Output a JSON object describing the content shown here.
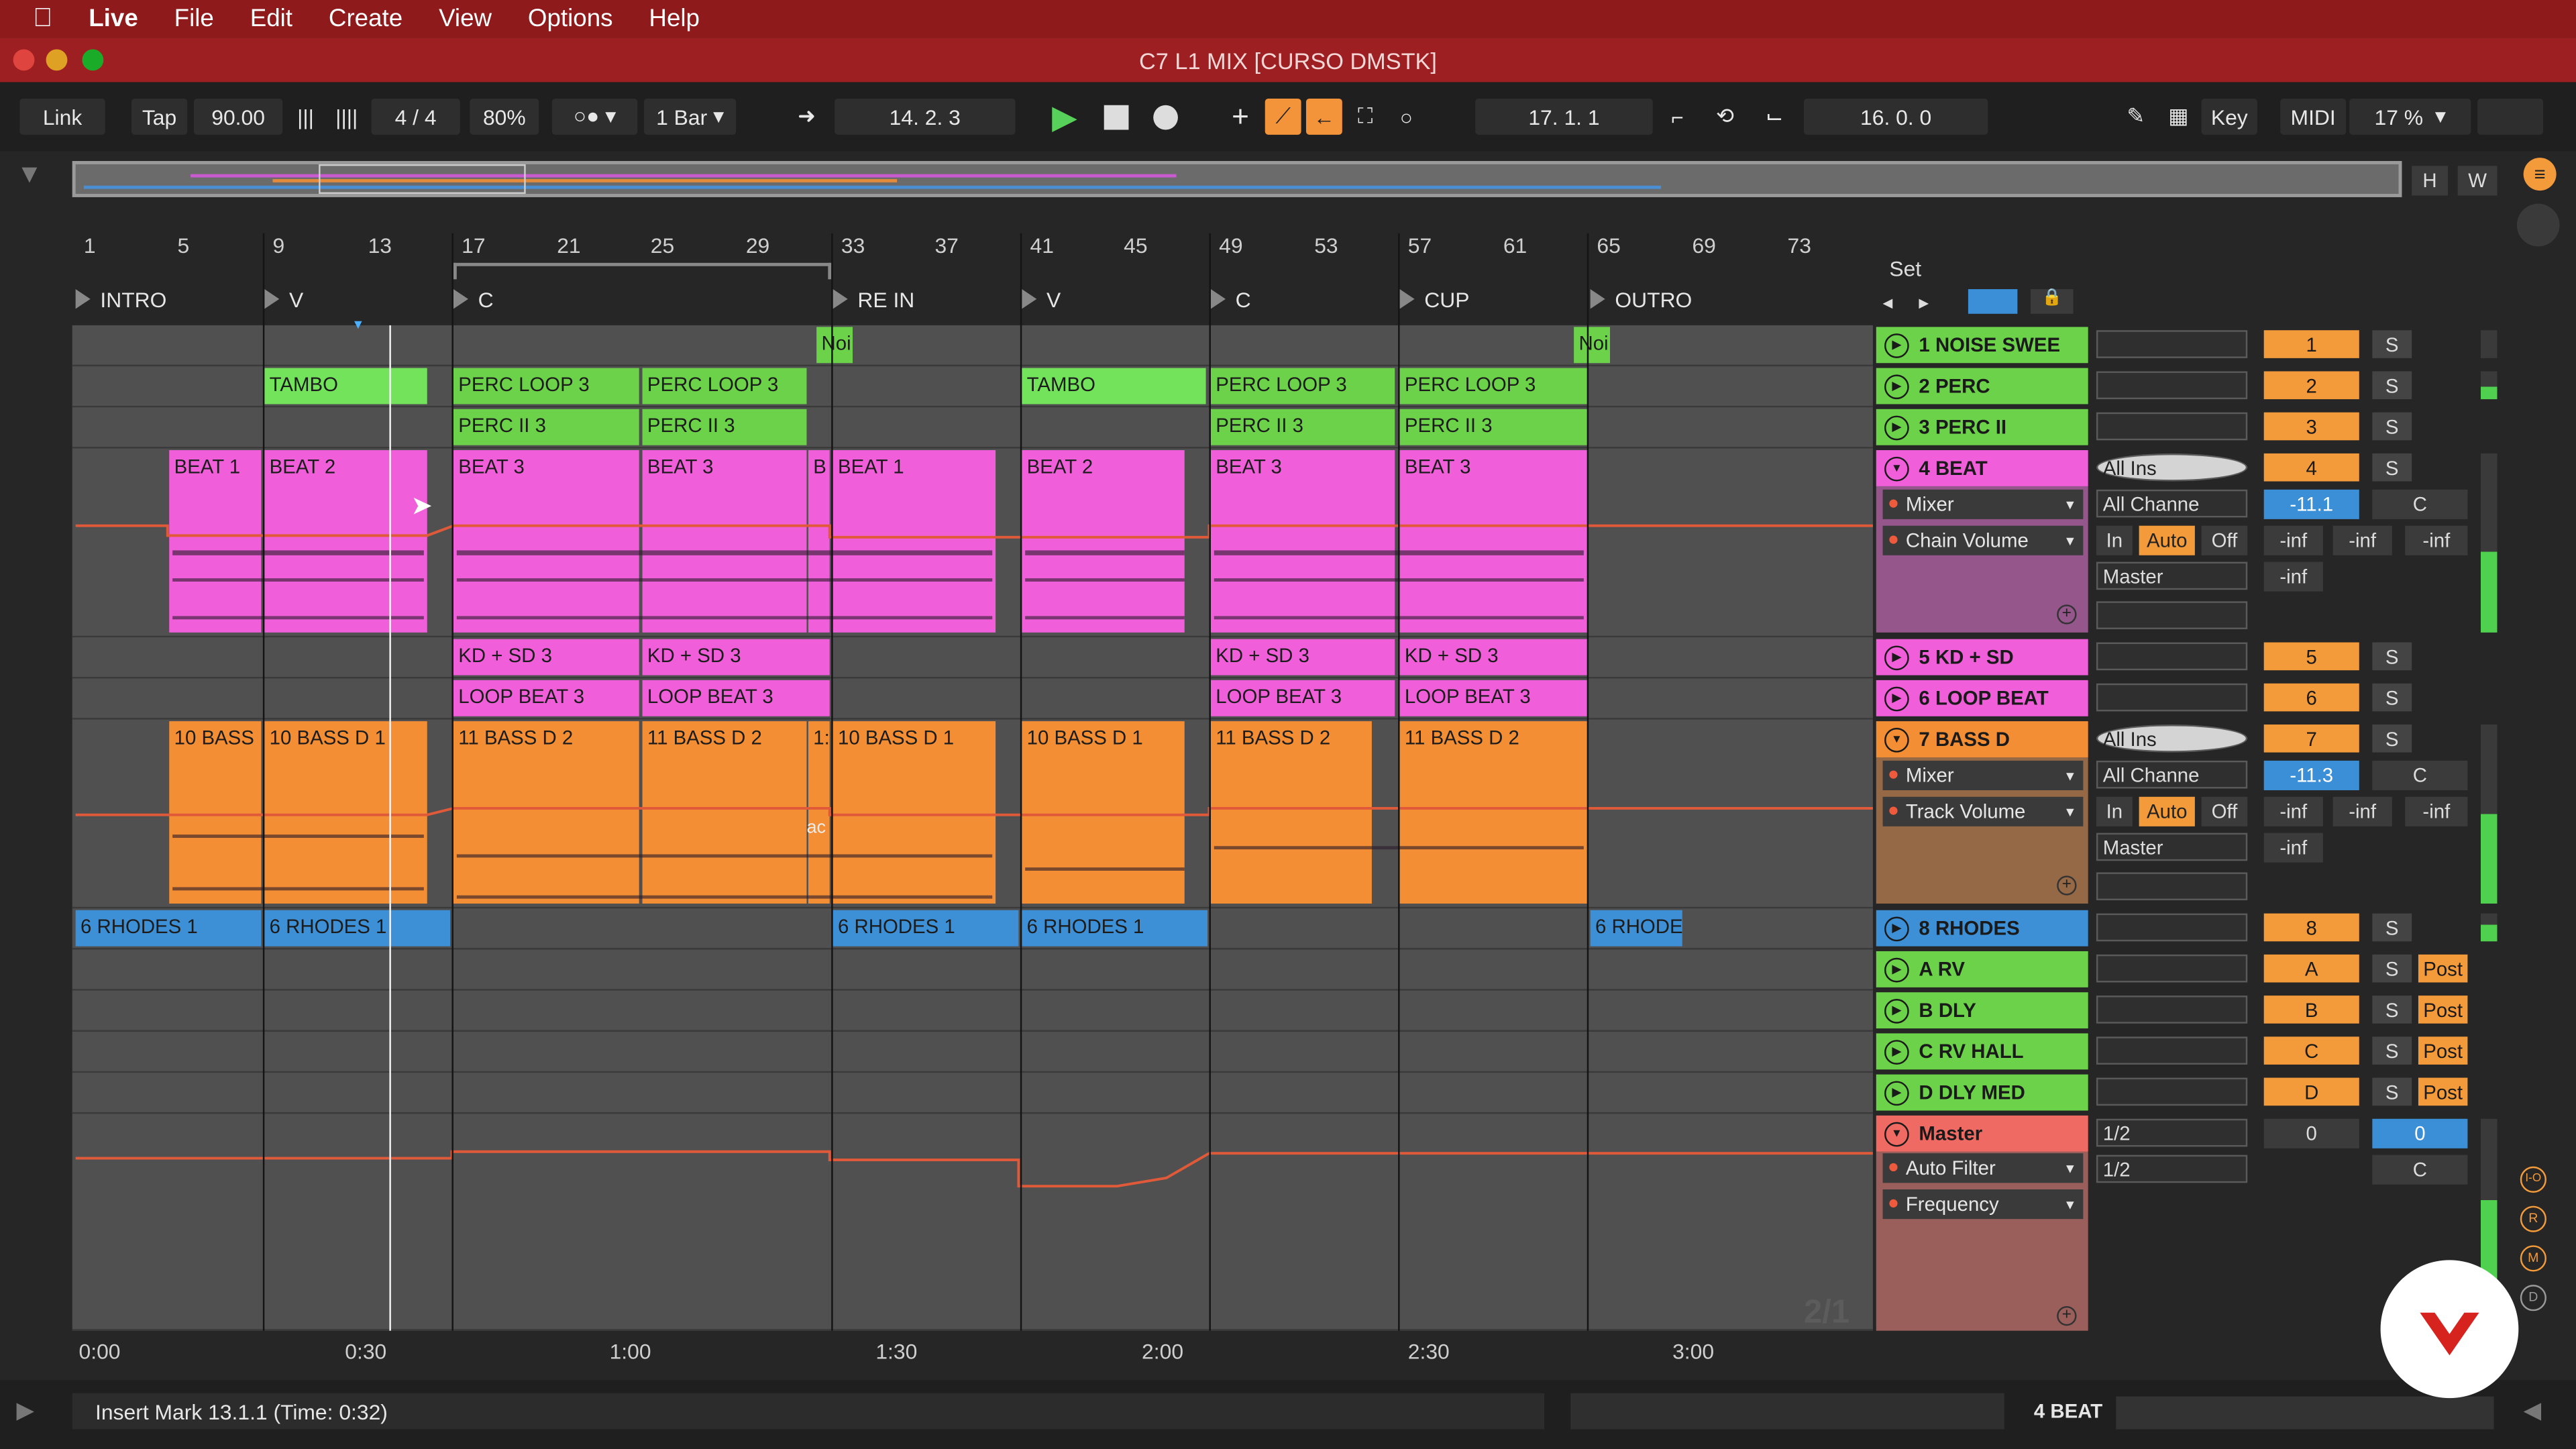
{
  "menubar": {
    "apple_icon": "apple-logo",
    "items": [
      "Live",
      "File",
      "Edit",
      "Create",
      "View",
      "Options",
      "Help"
    ]
  },
  "window": {
    "title": "C7 L1 MIX  [CURSO DMSTK]"
  },
  "transport": {
    "link": "Link",
    "tap": "Tap",
    "tempo": "90.00",
    "time_sig": "4 / 4",
    "groove_pct": "80%",
    "quantize": "1 Bar",
    "position": "14.   2.   3",
    "loop_start": "17.   1.   1",
    "loop_length": "16.   0.   0",
    "key": "Key",
    "midi": "MIDI",
    "cpu": "17 %"
  },
  "overview": {
    "h_btn": "H",
    "w_btn": "W"
  },
  "ruler": {
    "bars": [
      "1",
      "5",
      "9",
      "13",
      "17",
      "21",
      "25",
      "29",
      "33",
      "37",
      "41",
      "45",
      "49",
      "53",
      "57",
      "61",
      "65",
      "69",
      "73"
    ],
    "locators": [
      "INTRO",
      "V",
      "C",
      "RE IN",
      "V",
      "C",
      "CUP",
      "OUTRO"
    ],
    "set_label": "Set"
  },
  "clips": {
    "noise": [
      "Noi",
      "Noi"
    ],
    "perc": [
      "TAMBO",
      "PERC LOOP 3",
      "PERC LOOP 3",
      "TAMBO",
      "PERC LOOP 3",
      "PERC LOOP 3"
    ],
    "perc2": [
      "PERC II 3",
      "PERC II 3",
      "PERC II 3",
      "PERC II 3"
    ],
    "beat": [
      "BEAT 1",
      "BEAT 2",
      "BEAT 3",
      "BEAT 3",
      "B",
      "BEAT 1",
      "BEAT 2",
      "BEAT 3",
      "BEAT 3"
    ],
    "kdsd": [
      "KD + SD 3",
      "KD + SD 3",
      "KD + SD 3",
      "KD + SD 3"
    ],
    "loopbeat": [
      "LOOP BEAT 3",
      "LOOP BEAT 3",
      "LOOP BEAT 3",
      "LOOP BEAT 3"
    ],
    "bass": [
      "10 BASS",
      "10 BASS D 1",
      "11 BASS D 2",
      "11 BASS D 2",
      "1:",
      "10 BASS D 1",
      "10 BASS D 1",
      "11 BASS D 2",
      "11 BASS D 2"
    ],
    "bass_extra": "ac",
    "rhodes": [
      "6 RHODES 1",
      "6 RHODES 1",
      "6 RHODES 1",
      "6 RHODES 1",
      "6 RHODE"
    ]
  },
  "tracks": [
    {
      "name": "1 NOISE SWEE",
      "num": "1",
      "solo": "S",
      "color": "#6cd24a"
    },
    {
      "name": "2 PERC",
      "num": "2",
      "solo": "S",
      "color": "#6cd24a"
    },
    {
      "name": "3 PERC II",
      "num": "3",
      "solo": "S",
      "color": "#6cd24a"
    },
    {
      "name": "4 BEAT",
      "num": "4",
      "solo": "S",
      "color": "#f05fd9"
    },
    {
      "name": "5 KD + SD",
      "num": "5",
      "solo": "S",
      "color": "#f05fd9"
    },
    {
      "name": "6 LOOP BEAT",
      "num": "6",
      "solo": "S",
      "color": "#f05fd9"
    },
    {
      "name": "7 BASS D",
      "num": "7",
      "solo": "S",
      "color": "#f38e34"
    },
    {
      "name": "8 RHODES",
      "num": "8",
      "solo": "S",
      "color": "#3d8fd6"
    },
    {
      "name": "A RV",
      "num": "A",
      "solo": "S",
      "post": "Post",
      "color": "#6cd24a"
    },
    {
      "name": "B DLY",
      "num": "B",
      "solo": "S",
      "post": "Post",
      "color": "#6cd24a"
    },
    {
      "name": "C RV HALL",
      "num": "C",
      "solo": "S",
      "post": "Post",
      "color": "#6cd24a"
    },
    {
      "name": "D DLY MED",
      "num": "D",
      "solo": "S",
      "post": "Post",
      "color": "#6cd24a"
    },
    {
      "name": "Master",
      "color": "#f06a64"
    }
  ],
  "beat_detail": {
    "input": "All Ins",
    "device": "Mixer",
    "channel": "All Channe",
    "param": "Chain Volume",
    "monitor": [
      "In",
      "Auto",
      "Off"
    ],
    "out": "Master",
    "volume": "-11.1",
    "pan": "C",
    "sends": [
      "-inf",
      "-inf",
      "-inf"
    ],
    "peak": "-inf"
  },
  "bass_detail": {
    "input": "All Ins",
    "device": "Mixer",
    "channel": "All Channe",
    "param": "Track Volume",
    "monitor": [
      "In",
      "Auto",
      "Off"
    ],
    "out": "Master",
    "volume": "-11.3",
    "pan": "C",
    "sends": [
      "-inf",
      "-inf",
      "-inf"
    ],
    "peak": "-inf"
  },
  "master_detail": {
    "out1": "1/2",
    "out2": "1/2",
    "vol": "0",
    "cue": "0",
    "pan": "C",
    "device": "Auto Filter",
    "param": "Frequency",
    "badge": "2/1"
  },
  "side_buttons": [
    "I-O",
    "R",
    "M",
    "D"
  ],
  "time_axis": [
    "0:00",
    "0:30",
    "1:00",
    "1:30",
    "2:00",
    "2:30",
    "3:00"
  ],
  "status": {
    "message": "Insert Mark 13.1.1 (Time: 0:32)",
    "selected_track": "4 BEAT"
  }
}
